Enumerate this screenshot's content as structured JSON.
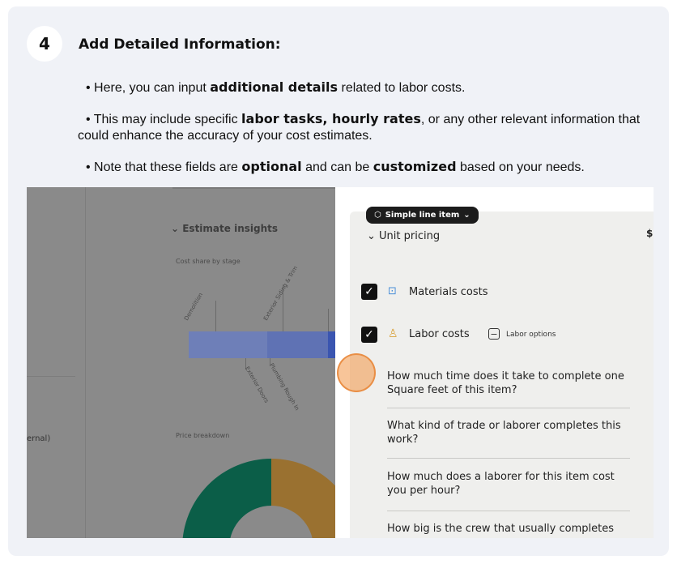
{
  "step": {
    "number": "4",
    "title": "Add Detailed Information:"
  },
  "bullets": [
    {
      "pre": "• Here, you can input ",
      "bold": "additional details",
      "post": " related to labor costs."
    },
    {
      "pre": "• This may include specific ",
      "bold": "labor tasks, hourly rates",
      "post": ", or any other relevant information that could enhance the accuracy of your cost estimates."
    },
    {
      "pre": "• Note that these fields are ",
      "bold": "optional",
      "mid": " and can be ",
      "bold2": "customized",
      "post": " based on your needs."
    }
  ],
  "screenshot": {
    "left": {
      "insights_title": "Estimate insights",
      "cost_share_label": "Cost share by stage",
      "stage_labels": [
        "Demolition",
        "Exterior Siding & Trim",
        "Exterior Doors",
        "Plumbing Rough In"
      ],
      "price_breakdown_label": "Price breakdown",
      "truncated_text": "ernal)",
      "donut_colors": {
        "green": "#0b5e48",
        "orange": "#9a7130"
      }
    },
    "right": {
      "pill_label": "Simple line item",
      "unit_pricing": "Unit pricing",
      "price_fragment": "$(",
      "materials_label": "Materials costs",
      "labor_label": "Labor costs",
      "labor_options": "Labor options",
      "questions": [
        "How much time does it take to complete one Square feet of this item?",
        "What kind of trade or laborer completes this work?",
        "How much does a laborer for this item cost you per hour?",
        "How big is the crew that usually completes"
      ]
    }
  }
}
